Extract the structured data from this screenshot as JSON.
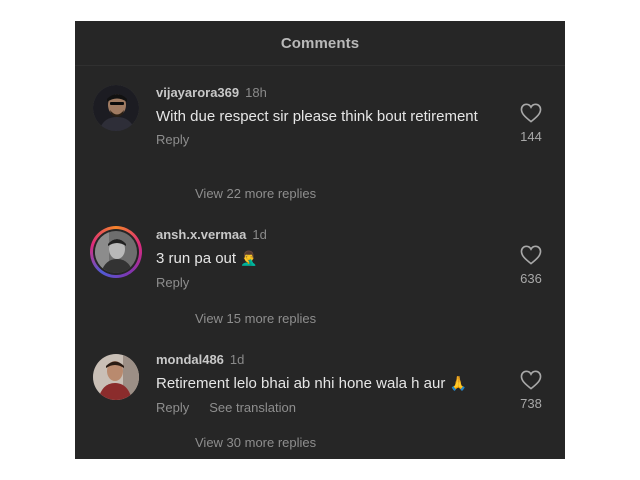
{
  "header": {
    "title": "Comments"
  },
  "comments": [
    {
      "username": "vijayarora369",
      "time": "18h",
      "text": "With due respect sir please think bout retirement",
      "reply_label": "Reply",
      "view_replies": "View 22 more replies",
      "likes": "144",
      "avatar": "man-portrait"
    },
    {
      "username": "ansh.x.vermaa",
      "time": "1d",
      "text": "3 run pa out",
      "emoji": "🤦‍♂️",
      "reply_label": "Reply",
      "view_replies": "View 15 more replies",
      "likes": "636",
      "avatar": "man-portrait-bw"
    },
    {
      "username": "mondal486",
      "time": "1d",
      "text": "Retirement lelo bhai ab nhi hone wala h aur",
      "emoji": "🙏",
      "reply_label": "Reply",
      "translation_label": "See translation",
      "view_replies": "View 30 more replies",
      "likes": "738",
      "avatar": "man-portrait-color"
    }
  ],
  "icons": {
    "like": "heart-outline-icon"
  },
  "colors": {
    "background": "#262626",
    "text": "#f5f5f5",
    "muted": "#8e8e8e"
  }
}
